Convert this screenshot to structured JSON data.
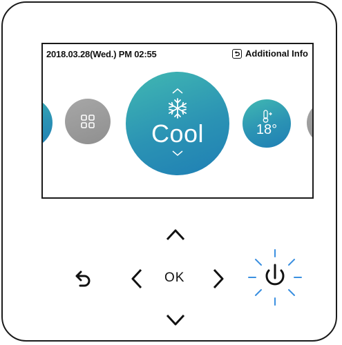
{
  "status_bar": {
    "datetime": "2018.03.28(Wed.)  PM 02:55",
    "additional_info_label": "Additional Info"
  },
  "mode_carousel": {
    "selected": {
      "label": "Cool",
      "icon": "snowflake-icon"
    },
    "items": [
      {
        "label": "",
        "icon": "partial-mode-icon"
      },
      {
        "label": "",
        "icon": "menu-grid-icon"
      },
      {
        "label": "Cool",
        "icon": "snowflake-icon"
      },
      {
        "label": "18°",
        "icon": "thermometer-icon"
      },
      {
        "label": "",
        "icon": "partial-mode-icon"
      }
    ]
  },
  "controls": {
    "ok_label": "OK",
    "power_state": "highlighted"
  },
  "colors": {
    "teal_start": "#41b8b2",
    "teal_end": "#1f7fb5",
    "gray": "#9a9a9a",
    "power_glow": "#3a8fe0"
  }
}
